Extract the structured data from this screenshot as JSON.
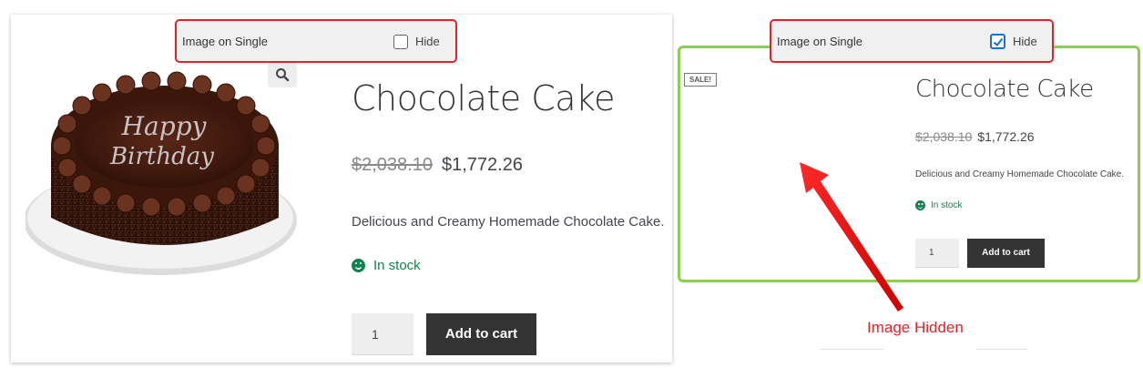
{
  "left_product": {
    "title": "Chocolate Cake",
    "old_price": "$2,038.10",
    "new_price": "$1,772.26",
    "description": "Delicious and Creamy Homemade Chocolate Cake.",
    "stock": "In stock",
    "quantity": "1",
    "add_to_cart": "Add to cart",
    "image_text": "Happy Birthday"
  },
  "right_product": {
    "sale_badge": "SALE!",
    "title": "Chocolate Cake",
    "old_price": "$2,038.10",
    "new_price": "$1,772.26",
    "description": "Delicious and Creamy Homemade Chocolate Cake.",
    "stock": "In stock",
    "quantity": "1",
    "add_to_cart": "Add to cart"
  },
  "toggle_left": {
    "label": "Image on Single",
    "option": "Hide",
    "checked": false
  },
  "toggle_right": {
    "label": "Image on Single",
    "option": "Hide",
    "checked": true
  },
  "annotation": {
    "text": "Image Hidden"
  },
  "colors": {
    "highlight_red": "#e0232b",
    "frame_green": "#8ccf4e",
    "stock_green": "#0f834d",
    "checkbox_blue": "#1e6fc8"
  },
  "icons": {
    "zoom": "magnifier-icon",
    "stock": "smiley-icon",
    "check": "checkmark-icon"
  }
}
